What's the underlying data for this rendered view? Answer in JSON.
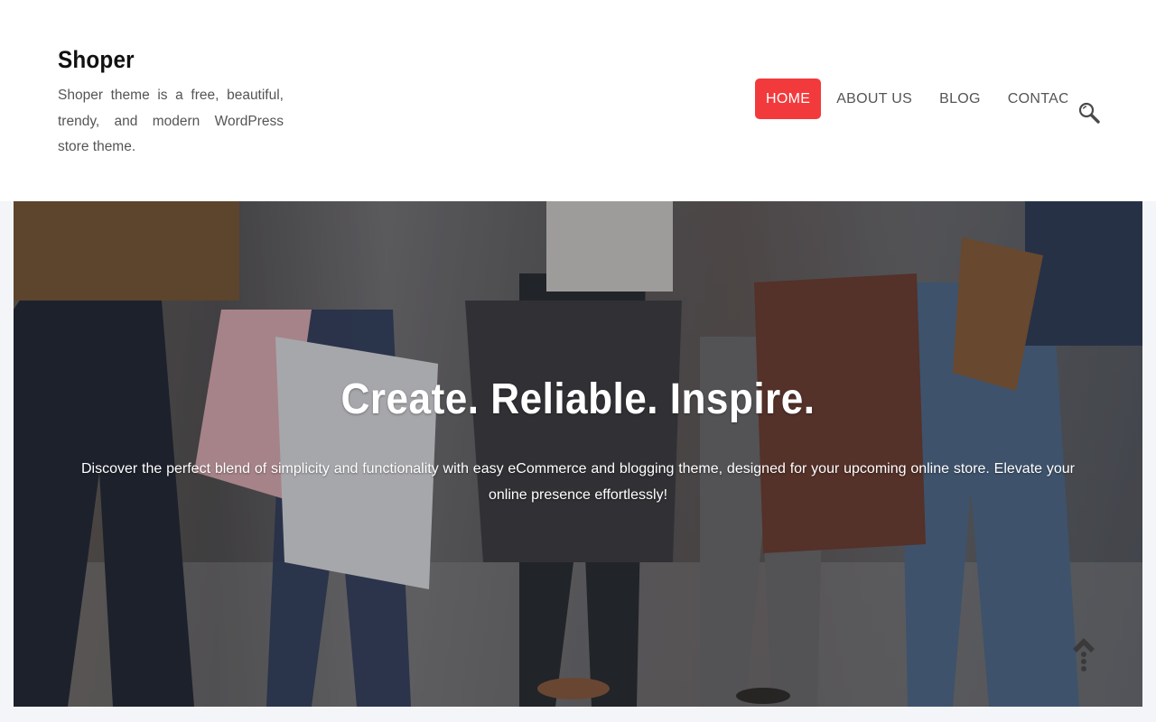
{
  "site": {
    "title": "Shoper",
    "tagline": "Shoper theme is a free, beautiful, trendy, and modern WordPress store theme."
  },
  "nav": {
    "items": [
      {
        "label": "HOME",
        "active": true
      },
      {
        "label": "ABOUT US",
        "active": false
      },
      {
        "label": "BLOG",
        "active": false
      },
      {
        "label": "CONTACT",
        "active": false
      }
    ],
    "search_icon": "search-icon"
  },
  "hero": {
    "title": "Create. Reliable. Inspire.",
    "text": "Discover the perfect blend of simplicity and functionality with easy eCommerce and blogging theme, designed for your upcoming online store. Elevate your online presence effortlessly!"
  },
  "scroll_top_icon": "scroll-to-top-icon",
  "colors": {
    "accent": "#f23a3c",
    "header_bg": "#ffffff",
    "page_bg": "#f4f5f8",
    "text": "#555555"
  }
}
